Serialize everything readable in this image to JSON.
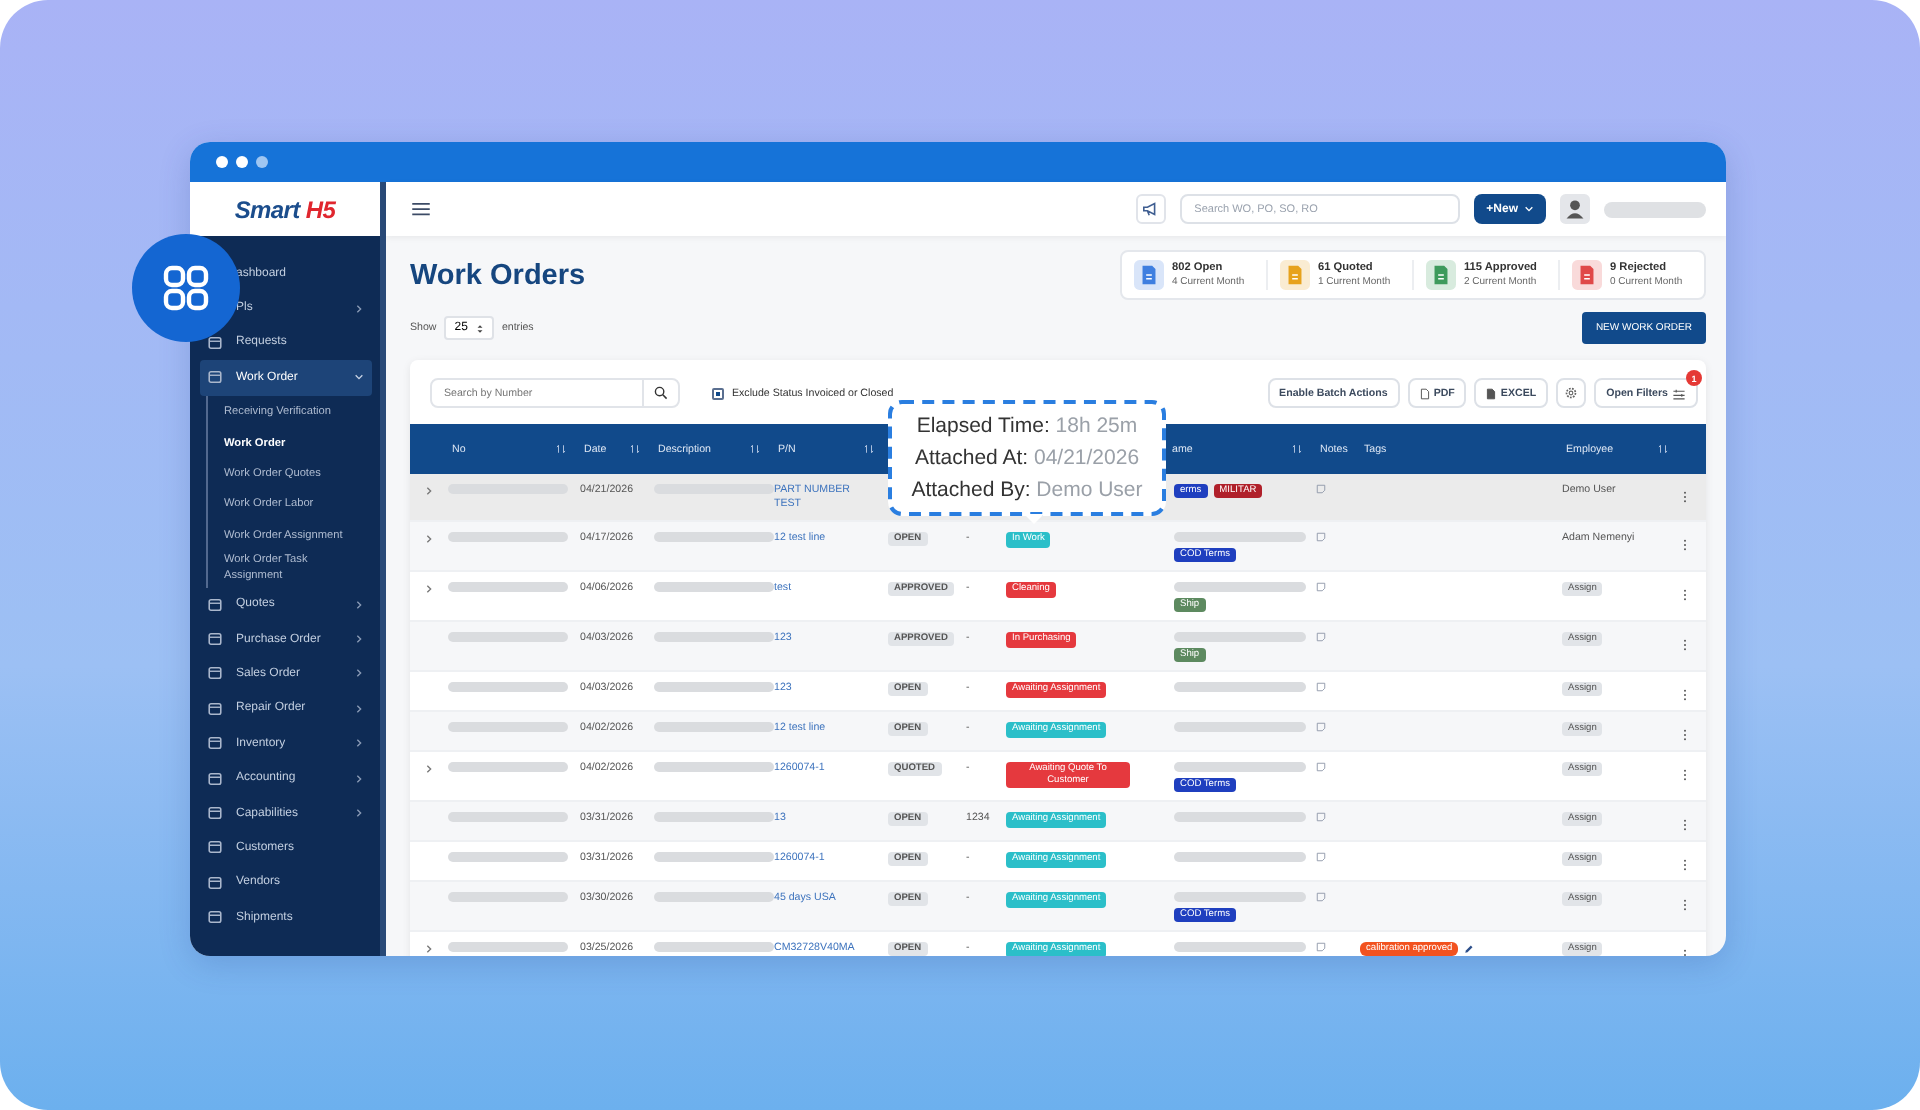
{
  "logo": {
    "text": "Smart",
    "mark": "H5"
  },
  "sidebar": {
    "items": [
      {
        "label": "ashboard",
        "submenu": false
      },
      {
        "label": "Pls",
        "submenu": true
      },
      {
        "label": "Requests",
        "submenu": false
      },
      {
        "label": "Work Order",
        "submenu": true,
        "expanded": true,
        "selected": true,
        "children": [
          {
            "label": "Receiving Verification",
            "selected": false
          },
          {
            "label": "Work Order",
            "selected": true
          },
          {
            "label": "Work Order Quotes",
            "selected": false
          },
          {
            "label": "Work Order Labor",
            "selected": false
          },
          {
            "label": "Work Order Assignment",
            "selected": false
          },
          {
            "label": "Work Order Task Assignment",
            "selected": false
          }
        ]
      },
      {
        "label": "Quotes",
        "submenu": true
      },
      {
        "label": "Purchase Order",
        "submenu": true
      },
      {
        "label": "Sales Order",
        "submenu": true
      },
      {
        "label": "Repair Order",
        "submenu": true
      },
      {
        "label": "Inventory",
        "submenu": true
      },
      {
        "label": "Accounting",
        "submenu": true
      },
      {
        "label": "Capabilities",
        "submenu": true
      },
      {
        "label": "Customers",
        "submenu": false
      },
      {
        "label": "Vendors",
        "submenu": false
      },
      {
        "label": "Shipments",
        "submenu": false
      }
    ]
  },
  "topbar": {
    "search_placeholder": "Search WO, PO, SO, RO",
    "new_button": "+New"
  },
  "page": {
    "title": "Work Orders"
  },
  "stats": [
    {
      "value": "802 Open",
      "sub": "4 Current Month",
      "color": "#3f7fe0"
    },
    {
      "value": "61 Quoted",
      "sub": "1 Current Month",
      "color": "#e7a21c"
    },
    {
      "value": "115 Approved",
      "sub": "2 Current Month",
      "color": "#3e9a5c"
    },
    {
      "value": "9 Rejected",
      "sub": "0 Current Month",
      "color": "#e04848"
    }
  ],
  "entries": {
    "show": "Show",
    "value": "25",
    "suffix": "entries"
  },
  "new_work_order": "NEW WORK ORDER",
  "toolbar": {
    "search_placeholder": "Search by Number",
    "exclude": {
      "label": "Exclude Status Invoiced or Closed",
      "checked": true
    },
    "buttons": [
      {
        "kind": "text",
        "label": "Enable Batch Actions"
      },
      {
        "kind": "pdf",
        "label": "PDF"
      },
      {
        "kind": "excel",
        "label": "EXCEL"
      },
      {
        "kind": "gear"
      },
      {
        "kind": "filters",
        "label": "Open Filters",
        "badge": "1"
      }
    ]
  },
  "table": {
    "columns": [
      {
        "label": "No",
        "sortable": true
      },
      {
        "label": "Date",
        "sortable": true
      },
      {
        "label": "Description",
        "sortable": true
      },
      {
        "label": "P/N",
        "sortable": true
      },
      {},
      {},
      {},
      {
        "label": "ame",
        "sortable": true
      },
      {
        "label": "Notes"
      },
      {
        "label": "Tags",
        "sortable": false
      },
      {
        "label": "Employee",
        "sortable": true
      }
    ],
    "rows": [
      {
        "expandable": true,
        "selected": true,
        "date": "04/21/2026",
        "pn": "PART NUMBER TEST",
        "name_tags": [
          {
            "text": "erms",
            "color": "#1f3fbf"
          },
          {
            "text": "MILITAR",
            "color": "#b0202a"
          }
        ],
        "employee": {
          "kind": "name",
          "text": "Demo User"
        }
      },
      {
        "expandable": true,
        "selected": false,
        "date": "04/17/2026",
        "pn": "12 test line",
        "status": "OPEN",
        "number": "-",
        "stage": {
          "text": "In Work",
          "color": "#2bbfc9"
        },
        "name_tags": [
          {
            "text": "COD Terms",
            "color": "#1f3fbf"
          }
        ],
        "employee": {
          "kind": "name",
          "text": "Adam Nemenyi"
        }
      },
      {
        "expandable": true,
        "selected": false,
        "date": "04/06/2026",
        "pn": "test",
        "status": "APPROVED",
        "number": "-",
        "stage": {
          "text": "Cleaning",
          "color": "#e5393e"
        },
        "name_tags": [
          {
            "text": "Ship",
            "color": "#5d8a60"
          }
        ],
        "employee": {
          "kind": "assign",
          "text": "Assign"
        }
      },
      {
        "expandable": false,
        "selected": false,
        "date": "04/03/2026",
        "pn": "123",
        "status": "APPROVED",
        "number": "-",
        "stage": {
          "text": "In Purchasing",
          "color": "#e5393e"
        },
        "name_tags": [
          {
            "text": "Ship",
            "color": "#5d8a60"
          }
        ],
        "employee": {
          "kind": "assign",
          "text": "Assign"
        }
      },
      {
        "expandable": false,
        "selected": false,
        "date": "04/03/2026",
        "pn": "123",
        "status": "OPEN",
        "number": "-",
        "stage": {
          "text": "Awaiting Assignment",
          "color": "#e5393e"
        },
        "employee": {
          "kind": "assign",
          "text": "Assign"
        }
      },
      {
        "expandable": false,
        "selected": false,
        "date": "04/02/2026",
        "pn": "12 test line",
        "status": "OPEN",
        "number": "-",
        "stage": {
          "text": "Awaiting Assignment",
          "color": "#2bbfc9"
        },
        "employee": {
          "kind": "assign",
          "text": "Assign"
        }
      },
      {
        "expandable": true,
        "selected": false,
        "date": "04/02/2026",
        "pn": "1260074-1",
        "status": "QUOTED",
        "number": "-",
        "stage": {
          "text": "Awaiting Quote To Customer",
          "color": "#e5393e"
        },
        "name_tags": [
          {
            "text": "COD Terms",
            "color": "#1f3fbf"
          }
        ],
        "employee": {
          "kind": "assign",
          "text": "Assign"
        }
      },
      {
        "expandable": false,
        "selected": false,
        "date": "03/31/2026",
        "pn": "13",
        "status": "OPEN",
        "number": "1234",
        "stage": {
          "text": "Awaiting Assignment",
          "color": "#2bbfc9"
        },
        "employee": {
          "kind": "assign",
          "text": "Assign"
        }
      },
      {
        "expandable": false,
        "selected": false,
        "date": "03/31/2026",
        "pn": "1260074-1",
        "status": "OPEN",
        "number": "-",
        "stage": {
          "text": "Awaiting Assignment",
          "color": "#2bbfc9"
        },
        "employee": {
          "kind": "assign",
          "text": "Assign"
        }
      },
      {
        "expandable": false,
        "selected": false,
        "date": "03/30/2026",
        "pn": "45 days USA",
        "status": "OPEN",
        "number": "-",
        "stage": {
          "text": "Awaiting Assignment",
          "color": "#2bbfc9"
        },
        "name_tags": [
          {
            "text": "COD Terms",
            "color": "#1f3fbf"
          }
        ],
        "employee": {
          "kind": "assign",
          "text": "Assign"
        }
      },
      {
        "expandable": true,
        "selected": false,
        "date": "03/25/2026",
        "pn": "CM32728V40MA",
        "status": "OPEN",
        "number": "-",
        "stage": {
          "text": "Awaiting Assignment",
          "color": "#2bbfc9"
        },
        "tags": [
          {
            "text": "calibration approved",
            "color": "#f2521f",
            "editable": true
          }
        ],
        "employee": {
          "kind": "assign",
          "text": "Assign"
        }
      }
    ]
  },
  "tooltip": {
    "lines": [
      {
        "label": "Elapsed Time:",
        "value": "18h 25m"
      },
      {
        "label": "Attached At:",
        "value": "04/21/2026"
      },
      {
        "label": "Attached By:",
        "value": "Demo User"
      }
    ]
  }
}
